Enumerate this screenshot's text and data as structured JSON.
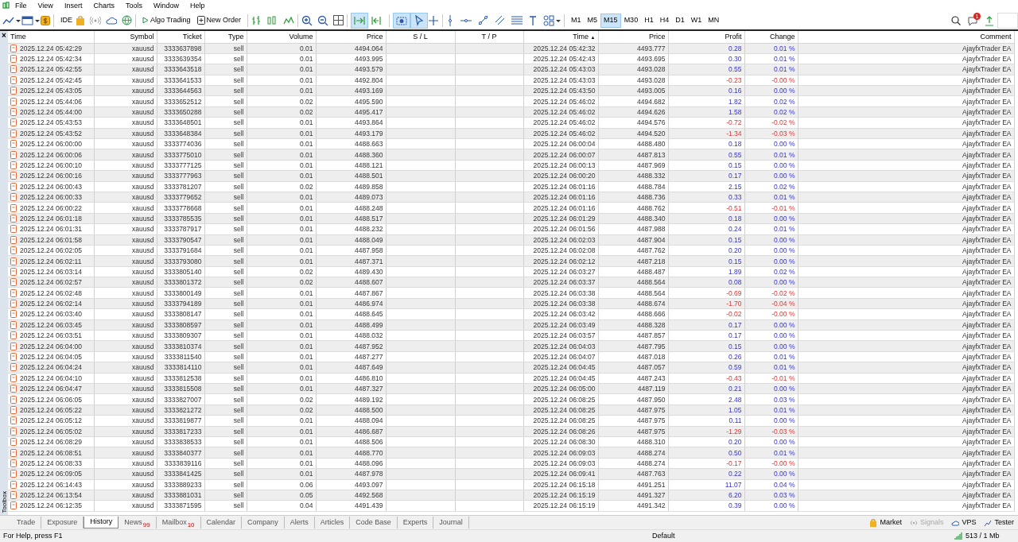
{
  "menu": [
    "File",
    "View",
    "Insert",
    "Charts",
    "Tools",
    "Window",
    "Help"
  ],
  "toolbar": {
    "ide": "IDE",
    "algo_trading": "Algo Trading",
    "new_order": "New Order",
    "toggles": [
      {
        "on": true
      },
      {
        "on": false
      },
      {
        "on": true
      },
      {
        "on": true
      }
    ],
    "timeframes": [
      {
        "label": "M1",
        "selected": false
      },
      {
        "label": "M5",
        "selected": false
      },
      {
        "label": "M15",
        "selected": true
      },
      {
        "label": "M30",
        "selected": false
      },
      {
        "label": "H1",
        "selected": false
      },
      {
        "label": "H4",
        "selected": false
      },
      {
        "label": "D1",
        "selected": false
      },
      {
        "label": "W1",
        "selected": false
      },
      {
        "label": "MN",
        "selected": false
      }
    ],
    "notification_count": "1"
  },
  "table": {
    "columns": [
      {
        "label": "Time"
      },
      {
        "label": "Symbol"
      },
      {
        "label": "Ticket"
      },
      {
        "label": "Type"
      },
      {
        "label": "Volume"
      },
      {
        "label": "Price"
      },
      {
        "label": "S / L"
      },
      {
        "label": "T / P"
      },
      {
        "label": "Time",
        "sort": "▲"
      },
      {
        "label": "Price"
      },
      {
        "label": "Profit"
      },
      {
        "label": "Change"
      },
      {
        "label": "Comment"
      }
    ],
    "rows": [
      {
        "open_time": "2025.12.24 05:42:29",
        "symbol": "xauusd",
        "ticket": "3333637898",
        "type": "sell",
        "volume": "0.01",
        "open_price": "4494.064",
        "close_time": "2025.12.24 05:42:32",
        "close_price": "4493.777",
        "profit": "0.28",
        "change": "0.01 %",
        "negative": false,
        "comment": "AjayfxTrader EA"
      },
      {
        "open_time": "2025.12.24 05:42:34",
        "symbol": "xauusd",
        "ticket": "3333639354",
        "type": "sell",
        "volume": "0.01",
        "open_price": "4493.995",
        "close_time": "2025.12.24 05:42:43",
        "close_price": "4493.695",
        "profit": "0.30",
        "change": "0.01 %",
        "negative": false,
        "comment": "AjayfxTrader EA"
      },
      {
        "open_time": "2025.12.24 05:42:55",
        "symbol": "xauusd",
        "ticket": "3333643518",
        "type": "sell",
        "volume": "0.01",
        "open_price": "4493.579",
        "close_time": "2025.12.24 05:43:03",
        "close_price": "4493.028",
        "profit": "0.55",
        "change": "0.01 %",
        "negative": false,
        "comment": "AjayfxTrader EA"
      },
      {
        "open_time": "2025.12.24 05:42:45",
        "symbol": "xauusd",
        "ticket": "3333641533",
        "type": "sell",
        "volume": "0.01",
        "open_price": "4492.804",
        "close_time": "2025.12.24 05:43:03",
        "close_price": "4493.028",
        "profit": "-0.23",
        "change": "-0.00 %",
        "negative": true,
        "comment": "AjayfxTrader EA"
      },
      {
        "open_time": "2025.12.24 05:43:05",
        "symbol": "xauusd",
        "ticket": "3333644563",
        "type": "sell",
        "volume": "0.01",
        "open_price": "4493.169",
        "close_time": "2025.12.24 05:43:50",
        "close_price": "4493.005",
        "profit": "0.16",
        "change": "0.00 %",
        "negative": false,
        "comment": "AjayfxTrader EA"
      },
      {
        "open_time": "2025.12.24 05:44:06",
        "symbol": "xauusd",
        "ticket": "3333652512",
        "type": "sell",
        "volume": "0.02",
        "open_price": "4495.590",
        "close_time": "2025.12.24 05:46:02",
        "close_price": "4494.682",
        "profit": "1.82",
        "change": "0.02 %",
        "negative": false,
        "comment": "AjayfxTrader EA"
      },
      {
        "open_time": "2025.12.24 05:44:00",
        "symbol": "xauusd",
        "ticket": "3333650288",
        "type": "sell",
        "volume": "0.02",
        "open_price": "4495.417",
        "close_time": "2025.12.24 05:46:02",
        "close_price": "4494.626",
        "profit": "1.58",
        "change": "0.02 %",
        "negative": false,
        "comment": "AjayfxTrader EA"
      },
      {
        "open_time": "2025.12.24 05:43:53",
        "symbol": "xauusd",
        "ticket": "3333648501",
        "type": "sell",
        "volume": "0.01",
        "open_price": "4493.864",
        "close_time": "2025.12.24 05:46:02",
        "close_price": "4494.576",
        "profit": "-0.72",
        "change": "-0.02 %",
        "negative": true,
        "comment": "AjayfxTrader EA"
      },
      {
        "open_time": "2025.12.24 05:43:52",
        "symbol": "xauusd",
        "ticket": "3333648384",
        "type": "sell",
        "volume": "0.01",
        "open_price": "4493.179",
        "close_time": "2025.12.24 05:46:02",
        "close_price": "4494.520",
        "profit": "-1.34",
        "change": "-0.03 %",
        "negative": true,
        "comment": "AjayfxTrader EA"
      },
      {
        "open_time": "2025.12.24 06:00:00",
        "symbol": "xauusd",
        "ticket": "3333774036",
        "type": "sell",
        "volume": "0.01",
        "open_price": "4488.663",
        "close_time": "2025.12.24 06:00:04",
        "close_price": "4488.480",
        "profit": "0.18",
        "change": "0.00 %",
        "negative": false,
        "comment": "AjayfxTrader EA"
      },
      {
        "open_time": "2025.12.24 06:00:06",
        "symbol": "xauusd",
        "ticket": "3333775010",
        "type": "sell",
        "volume": "0.01",
        "open_price": "4488.360",
        "close_time": "2025.12.24 06:00:07",
        "close_price": "4487.813",
        "profit": "0.55",
        "change": "0.01 %",
        "negative": false,
        "comment": "AjayfxTrader EA"
      },
      {
        "open_time": "2025.12.24 06:00:10",
        "symbol": "xauusd",
        "ticket": "3333777125",
        "type": "sell",
        "volume": "0.01",
        "open_price": "4488.121",
        "close_time": "2025.12.24 06:00:13",
        "close_price": "4487.969",
        "profit": "0.15",
        "change": "0.00 %",
        "negative": false,
        "comment": "AjayfxTrader EA"
      },
      {
        "open_time": "2025.12.24 06:00:16",
        "symbol": "xauusd",
        "ticket": "3333777963",
        "type": "sell",
        "volume": "0.01",
        "open_price": "4488.501",
        "close_time": "2025.12.24 06:00:20",
        "close_price": "4488.332",
        "profit": "0.17",
        "change": "0.00 %",
        "negative": false,
        "comment": "AjayfxTrader EA"
      },
      {
        "open_time": "2025.12.24 06:00:43",
        "symbol": "xauusd",
        "ticket": "3333781207",
        "type": "sell",
        "volume": "0.02",
        "open_price": "4489.858",
        "close_time": "2025.12.24 06:01:16",
        "close_price": "4488.784",
        "profit": "2.15",
        "change": "0.02 %",
        "negative": false,
        "comment": "AjayfxTrader EA"
      },
      {
        "open_time": "2025.12.24 06:00:33",
        "symbol": "xauusd",
        "ticket": "3333779652",
        "type": "sell",
        "volume": "0.01",
        "open_price": "4489.073",
        "close_time": "2025.12.24 06:01:16",
        "close_price": "4488.736",
        "profit": "0.33",
        "change": "0.01 %",
        "negative": false,
        "comment": "AjayfxTrader EA"
      },
      {
        "open_time": "2025.12.24 06:00:22",
        "symbol": "xauusd",
        "ticket": "3333778668",
        "type": "sell",
        "volume": "0.01",
        "open_price": "4488.248",
        "close_time": "2025.12.24 06:01:16",
        "close_price": "4488.762",
        "profit": "-0.51",
        "change": "-0.01 %",
        "negative": true,
        "comment": "AjayfxTrader EA"
      },
      {
        "open_time": "2025.12.24 06:01:18",
        "symbol": "xauusd",
        "ticket": "3333785535",
        "type": "sell",
        "volume": "0.01",
        "open_price": "4488.517",
        "close_time": "2025.12.24 06:01:29",
        "close_price": "4488.340",
        "profit": "0.18",
        "change": "0.00 %",
        "negative": false,
        "comment": "AjayfxTrader EA"
      },
      {
        "open_time": "2025.12.24 06:01:31",
        "symbol": "xauusd",
        "ticket": "3333787917",
        "type": "sell",
        "volume": "0.01",
        "open_price": "4488.232",
        "close_time": "2025.12.24 06:01:56",
        "close_price": "4487.988",
        "profit": "0.24",
        "change": "0.01 %",
        "negative": false,
        "comment": "AjayfxTrader EA"
      },
      {
        "open_time": "2025.12.24 06:01:58",
        "symbol": "xauusd",
        "ticket": "3333790547",
        "type": "sell",
        "volume": "0.01",
        "open_price": "4488.049",
        "close_time": "2025.12.24 06:02:03",
        "close_price": "4487.904",
        "profit": "0.15",
        "change": "0.00 %",
        "negative": false,
        "comment": "AjayfxTrader EA"
      },
      {
        "open_time": "2025.12.24 06:02:05",
        "symbol": "xauusd",
        "ticket": "3333791684",
        "type": "sell",
        "volume": "0.01",
        "open_price": "4487.958",
        "close_time": "2025.12.24 06:02:08",
        "close_price": "4487.762",
        "profit": "0.20",
        "change": "0.00 %",
        "negative": false,
        "comment": "AjayfxTrader EA"
      },
      {
        "open_time": "2025.12.24 06:02:11",
        "symbol": "xauusd",
        "ticket": "3333793080",
        "type": "sell",
        "volume": "0.01",
        "open_price": "4487.371",
        "close_time": "2025.12.24 06:02:12",
        "close_price": "4487.218",
        "profit": "0.15",
        "change": "0.00 %",
        "negative": false,
        "comment": "AjayfxTrader EA"
      },
      {
        "open_time": "2025.12.24 06:03:14",
        "symbol": "xauusd",
        "ticket": "3333805140",
        "type": "sell",
        "volume": "0.02",
        "open_price": "4489.430",
        "close_time": "2025.12.24 06:03:27",
        "close_price": "4488.487",
        "profit": "1.89",
        "change": "0.02 %",
        "negative": false,
        "comment": "AjayfxTrader EA"
      },
      {
        "open_time": "2025.12.24 06:02:57",
        "symbol": "xauusd",
        "ticket": "3333801372",
        "type": "sell",
        "volume": "0.02",
        "open_price": "4488.607",
        "close_time": "2025.12.24 06:03:37",
        "close_price": "4488.564",
        "profit": "0.08",
        "change": "0.00 %",
        "negative": false,
        "comment": "AjayfxTrader EA"
      },
      {
        "open_time": "2025.12.24 06:02:48",
        "symbol": "xauusd",
        "ticket": "3333800149",
        "type": "sell",
        "volume": "0.01",
        "open_price": "4487.867",
        "close_time": "2025.12.24 06:03:38",
        "close_price": "4488.564",
        "profit": "-0.69",
        "change": "-0.02 %",
        "negative": true,
        "comment": "AjayfxTrader EA"
      },
      {
        "open_time": "2025.12.24 06:02:14",
        "symbol": "xauusd",
        "ticket": "3333794189",
        "type": "sell",
        "volume": "0.01",
        "open_price": "4486.974",
        "close_time": "2025.12.24 06:03:38",
        "close_price": "4488.674",
        "profit": "-1.70",
        "change": "-0.04 %",
        "negative": true,
        "comment": "AjayfxTrader EA"
      },
      {
        "open_time": "2025.12.24 06:03:40",
        "symbol": "xauusd",
        "ticket": "3333808147",
        "type": "sell",
        "volume": "0.01",
        "open_price": "4488.645",
        "close_time": "2025.12.24 06:03:42",
        "close_price": "4488.666",
        "profit": "-0.02",
        "change": "-0.00 %",
        "negative": true,
        "comment": "AjayfxTrader EA"
      },
      {
        "open_time": "2025.12.24 06:03:45",
        "symbol": "xauusd",
        "ticket": "3333808597",
        "type": "sell",
        "volume": "0.01",
        "open_price": "4488.499",
        "close_time": "2025.12.24 06:03:49",
        "close_price": "4488.328",
        "profit": "0.17",
        "change": "0.00 %",
        "negative": false,
        "comment": "AjayfxTrader EA"
      },
      {
        "open_time": "2025.12.24 06:03:51",
        "symbol": "xauusd",
        "ticket": "3333809307",
        "type": "sell",
        "volume": "0.01",
        "open_price": "4488.032",
        "close_time": "2025.12.24 06:03:57",
        "close_price": "4487.857",
        "profit": "0.17",
        "change": "0.00 %",
        "negative": false,
        "comment": "AjayfxTrader EA"
      },
      {
        "open_time": "2025.12.24 06:04:00",
        "symbol": "xauusd",
        "ticket": "3333810374",
        "type": "sell",
        "volume": "0.01",
        "open_price": "4487.952",
        "close_time": "2025.12.24 06:04:03",
        "close_price": "4487.795",
        "profit": "0.15",
        "change": "0.00 %",
        "negative": false,
        "comment": "AjayfxTrader EA"
      },
      {
        "open_time": "2025.12.24 06:04:05",
        "symbol": "xauusd",
        "ticket": "3333811540",
        "type": "sell",
        "volume": "0.01",
        "open_price": "4487.277",
        "close_time": "2025.12.24 06:04:07",
        "close_price": "4487.018",
        "profit": "0.26",
        "change": "0.01 %",
        "negative": false,
        "comment": "AjayfxTrader EA"
      },
      {
        "open_time": "2025.12.24 06:04:24",
        "symbol": "xauusd",
        "ticket": "3333814110",
        "type": "sell",
        "volume": "0.01",
        "open_price": "4487.649",
        "close_time": "2025.12.24 06:04:45",
        "close_price": "4487.057",
        "profit": "0.59",
        "change": "0.01 %",
        "negative": false,
        "comment": "AjayfxTrader EA"
      },
      {
        "open_time": "2025.12.24 06:04:10",
        "symbol": "xauusd",
        "ticket": "3333812538",
        "type": "sell",
        "volume": "0.01",
        "open_price": "4486.810",
        "close_time": "2025.12.24 06:04:45",
        "close_price": "4487.243",
        "profit": "-0.43",
        "change": "-0.01 %",
        "negative": true,
        "comment": "AjayfxTrader EA"
      },
      {
        "open_time": "2025.12.24 06:04:47",
        "symbol": "xauusd",
        "ticket": "3333815508",
        "type": "sell",
        "volume": "0.01",
        "open_price": "4487.327",
        "close_time": "2025.12.24 06:05:00",
        "close_price": "4487.119",
        "profit": "0.21",
        "change": "0.00 %",
        "negative": false,
        "comment": "AjayfxTrader EA"
      },
      {
        "open_time": "2025.12.24 06:06:05",
        "symbol": "xauusd",
        "ticket": "3333827007",
        "type": "sell",
        "volume": "0.02",
        "open_price": "4489.192",
        "close_time": "2025.12.24 06:08:25",
        "close_price": "4487.950",
        "profit": "2.48",
        "change": "0.03 %",
        "negative": false,
        "comment": "AjayfxTrader EA"
      },
      {
        "open_time": "2025.12.24 06:05:22",
        "symbol": "xauusd",
        "ticket": "3333821272",
        "type": "sell",
        "volume": "0.02",
        "open_price": "4488.500",
        "close_time": "2025.12.24 06:08:25",
        "close_price": "4487.975",
        "profit": "1.05",
        "change": "0.01 %",
        "negative": false,
        "comment": "AjayfxTrader EA"
      },
      {
        "open_time": "2025.12.24 06:05:12",
        "symbol": "xauusd",
        "ticket": "3333819877",
        "type": "sell",
        "volume": "0.01",
        "open_price": "4488.094",
        "close_time": "2025.12.24 06:08:25",
        "close_price": "4487.975",
        "profit": "0.11",
        "change": "0.00 %",
        "negative": false,
        "comment": "AjayfxTrader EA"
      },
      {
        "open_time": "2025.12.24 06:05:02",
        "symbol": "xauusd",
        "ticket": "3333817233",
        "type": "sell",
        "volume": "0.01",
        "open_price": "4486.687",
        "close_time": "2025.12.24 06:08:26",
        "close_price": "4487.975",
        "profit": "-1.29",
        "change": "-0.03 %",
        "negative": true,
        "comment": "AjayfxTrader EA"
      },
      {
        "open_time": "2025.12.24 06:08:29",
        "symbol": "xauusd",
        "ticket": "3333838533",
        "type": "sell",
        "volume": "0.01",
        "open_price": "4488.506",
        "close_time": "2025.12.24 06:08:30",
        "close_price": "4488.310",
        "profit": "0.20",
        "change": "0.00 %",
        "negative": false,
        "comment": "AjayfxTrader EA"
      },
      {
        "open_time": "2025.12.24 06:08:51",
        "symbol": "xauusd",
        "ticket": "3333840377",
        "type": "sell",
        "volume": "0.01",
        "open_price": "4488.770",
        "close_time": "2025.12.24 06:09:03",
        "close_price": "4488.274",
        "profit": "0.50",
        "change": "0.01 %",
        "negative": false,
        "comment": "AjayfxTrader EA"
      },
      {
        "open_time": "2025.12.24 06:08:33",
        "symbol": "xauusd",
        "ticket": "3333839116",
        "type": "sell",
        "volume": "0.01",
        "open_price": "4488.096",
        "close_time": "2025.12.24 06:09:03",
        "close_price": "4488.274",
        "profit": "-0.17",
        "change": "-0.00 %",
        "negative": true,
        "comment": "AjayfxTrader EA"
      },
      {
        "open_time": "2025.12.24 06:09:05",
        "symbol": "xauusd",
        "ticket": "3333841425",
        "type": "sell",
        "volume": "0.01",
        "open_price": "4487.978",
        "close_time": "2025.12.24 06:09:41",
        "close_price": "4487.763",
        "profit": "0.22",
        "change": "0.00 %",
        "negative": false,
        "comment": "AjayfxTrader EA"
      },
      {
        "open_time": "2025.12.24 06:14:43",
        "symbol": "xauusd",
        "ticket": "3333889233",
        "type": "sell",
        "volume": "0.06",
        "open_price": "4493.097",
        "close_time": "2025.12.24 06:15:18",
        "close_price": "4491.251",
        "profit": "11.07",
        "change": "0.04 %",
        "negative": false,
        "comment": "AjayfxTrader EA"
      },
      {
        "open_time": "2025.12.24 06:13:54",
        "symbol": "xauusd",
        "ticket": "3333881031",
        "type": "sell",
        "volume": "0.05",
        "open_price": "4492.568",
        "close_time": "2025.12.24 06:15:19",
        "close_price": "4491.327",
        "profit": "6.20",
        "change": "0.03 %",
        "negative": false,
        "comment": "AjayfxTrader EA"
      },
      {
        "open_time": "2025.12.24 06:12:35",
        "symbol": "xauusd",
        "ticket": "3333871595",
        "type": "sell",
        "volume": "0.04",
        "open_price": "4491.439",
        "close_time": "2025.12.24 06:15:19",
        "close_price": "4491.342",
        "profit": "0.39",
        "change": "0.00 %",
        "negative": false,
        "comment": "AjayfxTrader EA"
      }
    ]
  },
  "side_label": "Toolbox",
  "close_symbol": "×",
  "bottom_tabs": [
    {
      "label": "Trade",
      "selected": false
    },
    {
      "label": "Exposure",
      "selected": false
    },
    {
      "label": "History",
      "selected": true
    },
    {
      "label": "News",
      "count": "99",
      "selected": false
    },
    {
      "label": "Mailbox",
      "count": "10",
      "selected": false
    },
    {
      "label": "Calendar",
      "selected": false
    },
    {
      "label": "Company",
      "selected": false
    },
    {
      "label": "Alerts",
      "selected": false
    },
    {
      "label": "Articles",
      "selected": false
    },
    {
      "label": "Code Base",
      "selected": false
    },
    {
      "label": "Experts",
      "selected": false
    },
    {
      "label": "Journal",
      "selected": false
    }
  ],
  "service_tabs": [
    {
      "label": "Market",
      "disabled": false
    },
    {
      "label": "Signals",
      "disabled": true
    },
    {
      "label": "VPS",
      "disabled": false
    },
    {
      "label": "Tester",
      "disabled": false
    }
  ],
  "status_bar": {
    "help": "For Help, press F1",
    "profile": "Default",
    "traffic": "513 / 1 Mb"
  }
}
